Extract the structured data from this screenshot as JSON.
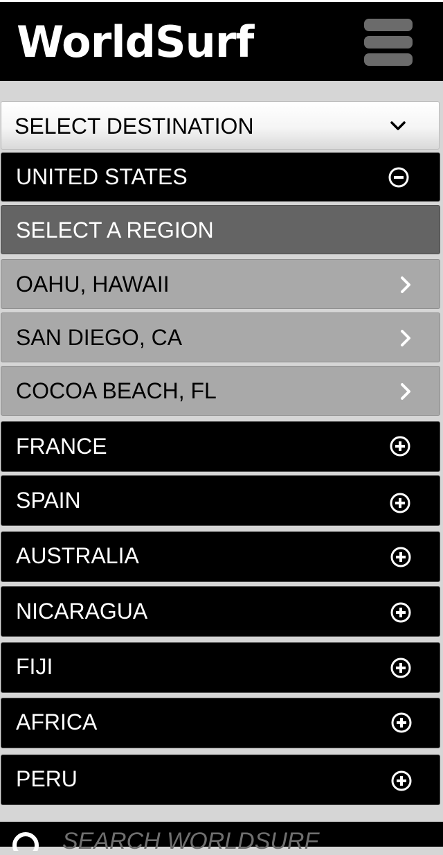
{
  "header": {
    "logo": "WorldSurf",
    "menu_icon": "hamburger-menu-icon"
  },
  "destination_select": {
    "label": "SELECT DESTINATION",
    "icon": "chevron-down-icon"
  },
  "expanded_country": {
    "label": "UNITED STATES",
    "icon": "minus-circle-icon"
  },
  "region_header": {
    "label": "SELECT A REGION"
  },
  "regions": [
    {
      "label": "OAHU, HAWAII",
      "icon": "chevron-right-icon"
    },
    {
      "label": "SAN DIEGO, CA",
      "icon": "chevron-right-icon"
    },
    {
      "label": "COCOA BEACH, FL",
      "icon": "chevron-right-icon"
    }
  ],
  "countries": [
    {
      "label": "FRANCE",
      "icon": "plus-circle-icon"
    },
    {
      "label": "SPAIN",
      "icon": "plus-circle-icon"
    },
    {
      "label": "AUSTRALIA",
      "icon": "plus-circle-icon"
    },
    {
      "label": "NICARAGUA",
      "icon": "plus-circle-icon"
    },
    {
      "label": "FIJI",
      "icon": "plus-circle-icon"
    },
    {
      "label": "AFRICA",
      "icon": "plus-circle-icon"
    },
    {
      "label": "PERU",
      "icon": "plus-circle-icon"
    }
  ],
  "search": {
    "placeholder": "SEARCH WORLDSURF",
    "icon": "search-icon"
  },
  "colors": {
    "background": "#d6d6d6",
    "header": "#000000",
    "region_header": "#646464",
    "region_item": "#a9a9a9",
    "country_item": "#000000"
  }
}
